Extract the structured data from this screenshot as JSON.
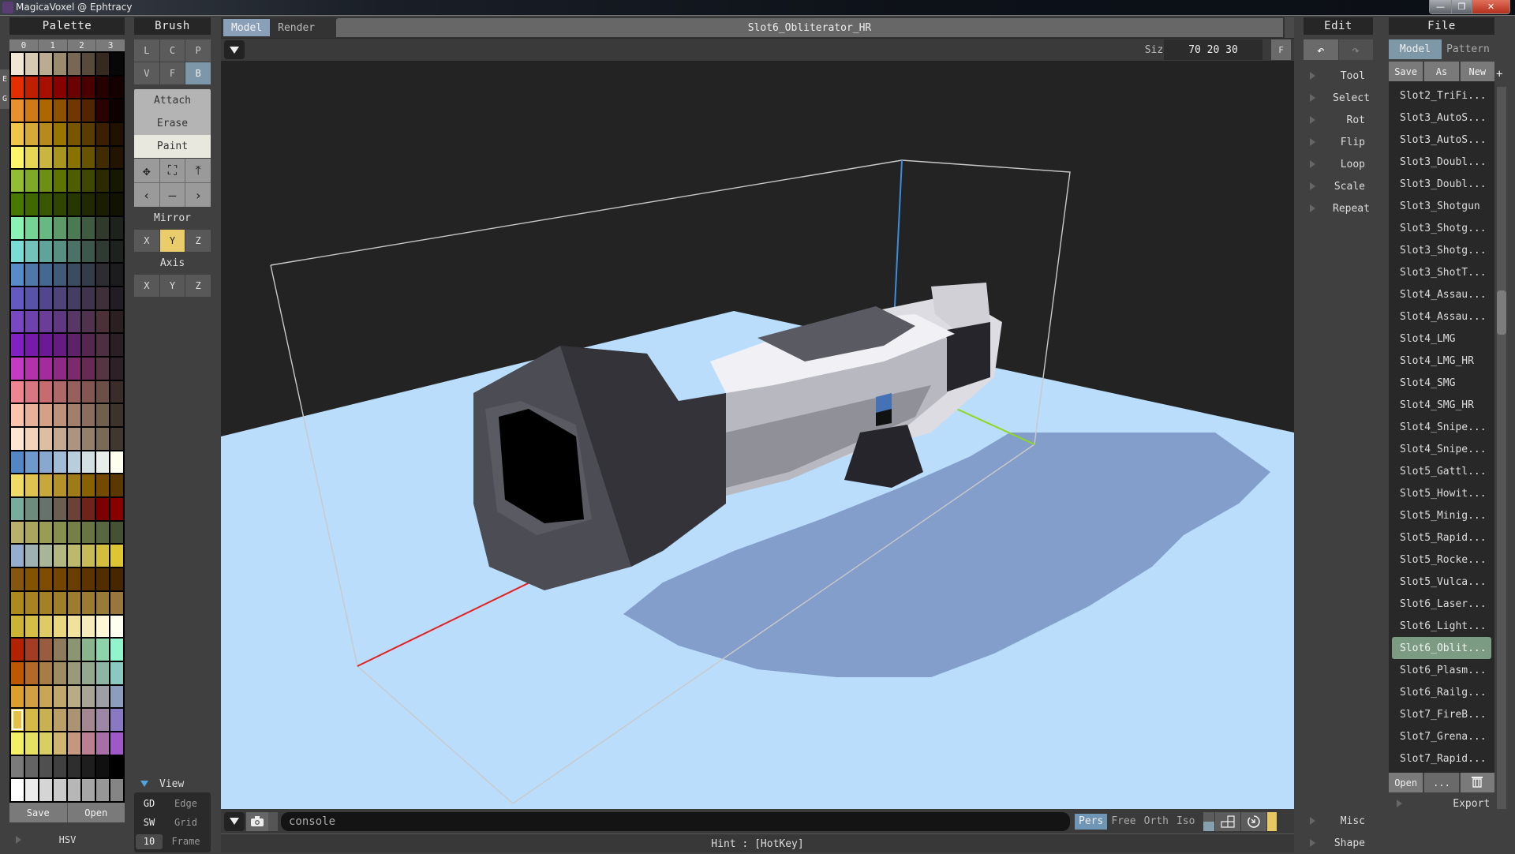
{
  "window": {
    "title": "MagicaVoxel @ Ephtracy",
    "minimize": "—",
    "maximize": "❐",
    "close": "✕"
  },
  "palette": {
    "title": "Palette",
    "tabs": [
      "0",
      "1",
      "2",
      "3"
    ],
    "side_labels": [
      "E",
      "G"
    ],
    "selected_index": 224,
    "colors": [
      "#f1e6d3",
      "#d7cab2",
      "#baab91",
      "#9a8a70",
      "#786752",
      "#574a3b",
      "#352920",
      "#070707",
      "#e32e00",
      "#be1f00",
      "#a71000",
      "#880000",
      "#6b0000",
      "#4b0000",
      "#260000",
      "#140000",
      "#e8902e",
      "#cd7a17",
      "#ad6700",
      "#8d5100",
      "#703800",
      "#512500",
      "#2a0000",
      "#0f0000",
      "#f2c64b",
      "#d7aa35",
      "#b78a1e",
      "#987500",
      "#785600",
      "#593c00",
      "#3a2000",
      "#1f1000",
      "#fff46a",
      "#e6d754",
      "#c9b641",
      "#a89521",
      "#887300",
      "#675300",
      "#412b00",
      "#221400",
      "#92be35",
      "#7faa27",
      "#6e8e16",
      "#5e7400",
      "#4d5d00",
      "#3e4600",
      "#2c2b00",
      "#171800",
      "#477800",
      "#406800",
      "#385700",
      "#2f4600",
      "#273700",
      "#1f2800",
      "#1a1d00",
      "#111300",
      "#8af2b4",
      "#75d495",
      "#68b882",
      "#5e9969",
      "#4a7a52",
      "#3e5a40",
      "#2f3a2d",
      "#1e221c",
      "#7bdcd6",
      "#72c4bb",
      "#5fa39b",
      "#578f83",
      "#4a7267",
      "#3e574d",
      "#2f3a33",
      "#1e221e",
      "#568cc7",
      "#4e78aa",
      "#44688f",
      "#405a78",
      "#3a4d60",
      "#333d49",
      "#2d2d31",
      "#1c1c1e",
      "#6259c1",
      "#5953a8",
      "#52468f",
      "#4e4479",
      "#463d63",
      "#40344c",
      "#3e2f38",
      "#221d24",
      "#7748c2",
      "#6f41ad",
      "#6a3e98",
      "#5e3881",
      "#583666",
      "#51324e",
      "#4b3037",
      "#2a2022",
      "#8121c2",
      "#761ba9",
      "#6c1995",
      "#661b80",
      "#5e2268",
      "#552650",
      "#4e2f42",
      "#291f25",
      "#c33ac3",
      "#b431ac",
      "#a32b9c",
      "#8e2a85",
      "#7c2a6e",
      "#672a54",
      "#553541",
      "#2d2026",
      "#ee8591",
      "#d87782",
      "#c66c6f",
      "#ae6868",
      "#97605c",
      "#845652",
      "#6c4f46",
      "#3a2c28",
      "#fdc3ac",
      "#e7b299",
      "#d3a186",
      "#bd917a",
      "#a27f6b",
      "#8a6d5c",
      "#715f4e",
      "#3d332a",
      "#ffe6d2",
      "#f2d3ba",
      "#dcbfa3",
      "#c5aa93",
      "#ad9480",
      "#947f6b",
      "#7b6957",
      "#40382e",
      "#5286c4",
      "#6d99cd",
      "#88a8d0",
      "#a2bcd8",
      "#b8cedd",
      "#d2dfe3",
      "#e7eee9",
      "#fffff0",
      "#f0db67",
      "#e0c24e",
      "#c8a83c",
      "#b3922c",
      "#9e7a18",
      "#886200",
      "#744a00",
      "#5a3800",
      "#78ac9c",
      "#6e8c7e",
      "#66726a",
      "#6a5e52",
      "#6c4238",
      "#6e241a",
      "#7c0000",
      "#880000",
      "#b9b16b",
      "#aaa65e",
      "#999d54",
      "#878f4e",
      "#777f48",
      "#677444",
      "#58673f",
      "#455133",
      "#96aece",
      "#9fb2b3",
      "#a8b598",
      "#b3b882",
      "#bcb86c",
      "#c6bb58",
      "#d2bd3f",
      "#dec533",
      "#855512",
      "#845300",
      "#7e4c00",
      "#744500",
      "#6a3e00",
      "#5d3400",
      "#522d00",
      "#472700",
      "#ad8a1d",
      "#a78420",
      "#a38126",
      "#9f7e2a",
      "#9e7c2f",
      "#9b7b34",
      "#9a7a37",
      "#98763c",
      "#cdb335",
      "#d4bf44",
      "#dfcb66",
      "#e8d680",
      "#f0e29c",
      "#f6ecbb",
      "#fdf7d6",
      "#fefff0",
      "#b22200",
      "#a23d24",
      "#985d40",
      "#8e7b5c",
      "#8b9572",
      "#89b58c",
      "#8dd4ab",
      "#92f4cc",
      "#bd5800",
      "#b36928",
      "#a77c47",
      "#9d8c62",
      "#9a9a7a",
      "#94a88f",
      "#8eb4a3",
      "#8ac9c2",
      "#dc9e2c",
      "#d1a040",
      "#c9a655",
      "#c0a86c",
      "#b8ab85",
      "#a8a597",
      "#9e9ea5",
      "#8d9dbd",
      "#e2c144",
      "#d5ba45",
      "#c9b153",
      "#baa066",
      "#ab9373",
      "#a38892",
      "#9d86a6",
      "#8a79c2",
      "#f3f065",
      "#e6e160",
      "#d7cf63",
      "#ceb571",
      "#c3987e",
      "#b98091",
      "#a86ea8",
      "#9e58c8",
      "#7a7a7a",
      "#646464",
      "#4f4f4f",
      "#404040",
      "#2e2e2e",
      "#1e1e1e",
      "#101010",
      "#000000",
      "#ffffff",
      "#ebebeb",
      "#d5d5d5",
      "#cacaca",
      "#b7b7b7",
      "#a6a6a6",
      "#979797",
      "#858585"
    ],
    "save_label": "Save",
    "open_label": "Open",
    "hsv_label": "HSV"
  },
  "brush": {
    "title": "Brush",
    "types": [
      {
        "label": "L"
      },
      {
        "label": "C"
      },
      {
        "label": "P"
      },
      {
        "label": "V"
      },
      {
        "label": "F"
      },
      {
        "label": "B",
        "active": true
      }
    ],
    "modes": [
      {
        "label": "Attach"
      },
      {
        "label": "Erase"
      },
      {
        "label": "Paint",
        "active": true
      }
    ],
    "tools": [
      "✥",
      "⛶",
      "⤒",
      "‹",
      "—",
      "›"
    ],
    "mirror_label": "Mirror",
    "mirror": [
      {
        "label": "X"
      },
      {
        "label": "Y",
        "active": true
      },
      {
        "label": "Z"
      }
    ],
    "axis_label": "Axis",
    "axis": [
      {
        "label": "X"
      },
      {
        "label": "Y"
      },
      {
        "label": "Z"
      }
    ]
  },
  "view": {
    "label": "View",
    "rows": [
      {
        "key": "GD",
        "value": "Edge"
      },
      {
        "key": "SW",
        "value": "Grid"
      },
      {
        "key": "10",
        "value": "Frame"
      }
    ]
  },
  "viewport": {
    "tabs": [
      {
        "label": "Model",
        "active": true
      },
      {
        "label": "Render"
      }
    ],
    "model_name": "Slot6_Obliterator_HR",
    "size_label": "Size",
    "size_value": "70 20 30",
    "size_f": "F",
    "console_placeholder": "console",
    "projections": [
      {
        "label": "Pers",
        "active": true
      },
      {
        "label": "Free"
      },
      {
        "label": "Orth"
      },
      {
        "label": "Iso"
      }
    ],
    "hint": "Hint : [HotKey]",
    "colors": {
      "ground": "#b8ddfb",
      "shadow": "#7f9ac8",
      "sky": "#232323",
      "axis_x": "#e52020",
      "axis_y": "#8fd81f",
      "axis_z": "#3d8ce0",
      "bounds": "#c9c9c9"
    }
  },
  "edit": {
    "title": "Edit",
    "undo_icon": "↶",
    "redo_icon": "↷",
    "items": [
      "Tool",
      "Select",
      "Rot",
      "Flip",
      "Loop",
      "Scale",
      "Repeat"
    ],
    "bottom_items": [
      "Misc",
      "Shape"
    ]
  },
  "file": {
    "title": "File",
    "tabs": [
      {
        "label": "Model",
        "active": true
      },
      {
        "label": "Pattern"
      }
    ],
    "actions": [
      "Save",
      "As",
      "New"
    ],
    "plus": "+",
    "items": [
      "Slot2_TriFi...",
      "Slot3_AutoS...",
      "Slot3_AutoS...",
      "Slot3_Doubl...",
      "Slot3_Doubl...",
      "Slot3_Shotgun",
      "Slot3_Shotg...",
      "Slot3_Shotg...",
      "Slot3_ShotT...",
      "Slot4_Assau...",
      "Slot4_Assau...",
      "Slot4_LMG",
      "Slot4_LMG_HR",
      "Slot4_SMG",
      "Slot4_SMG_HR",
      "Slot4_Snipe...",
      "Slot4_Snipe...",
      "Slot5_Gattl...",
      "Slot5_Howit...",
      "Slot5_Minig...",
      "Slot5_Rapid...",
      "Slot5_Rocke...",
      "Slot5_Vulca...",
      "Slot6_Laser...",
      "Slot6_Light...",
      "Slot6_Oblit...",
      "Slot6_Plasm...",
      "Slot6_Railg...",
      "Slot7_FireB...",
      "Slot7_Grena...",
      "Slot7_Rapid..."
    ],
    "selected_index": 25,
    "open_label": "Open",
    "more_label": "...",
    "delete_icon": "🗑",
    "export_label": "Export"
  }
}
